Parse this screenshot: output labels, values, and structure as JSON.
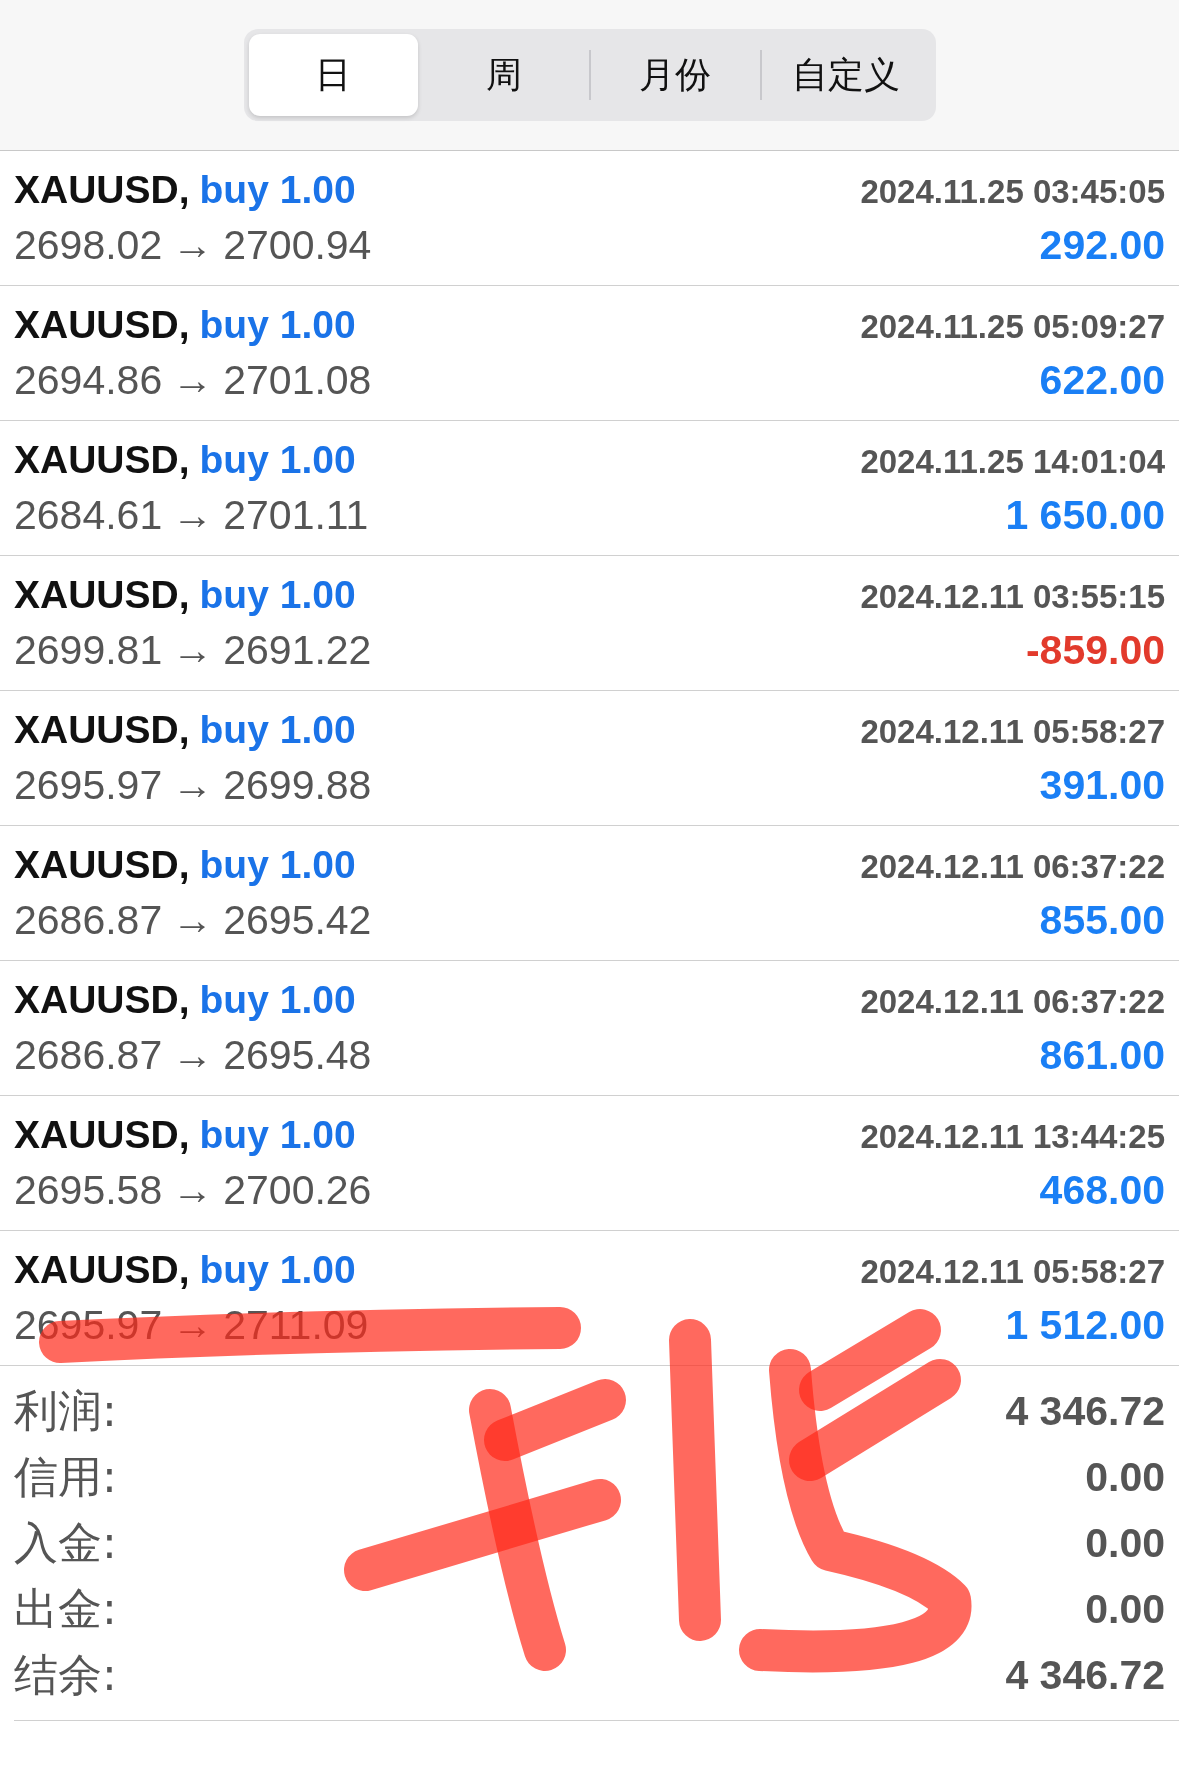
{
  "tabs": [
    {
      "label": "日",
      "selected": true
    },
    {
      "label": "周",
      "selected": false
    },
    {
      "label": "月份",
      "selected": false
    },
    {
      "label": "自定义",
      "selected": false
    }
  ],
  "deals": [
    {
      "symbol": "XAUUSD,",
      "side": "buy 1.00",
      "time": "2024.11.25 03:45:05",
      "open": "2698.02",
      "arrow": "→",
      "close": "2700.94",
      "profit": "292.00",
      "loss": false
    },
    {
      "symbol": "XAUUSD,",
      "side": "buy 1.00",
      "time": "2024.11.25 05:09:27",
      "open": "2694.86",
      "arrow": "→",
      "close": "2701.08",
      "profit": "622.00",
      "loss": false
    },
    {
      "symbol": "XAUUSD,",
      "side": "buy 1.00",
      "time": "2024.11.25 14:01:04",
      "open": "2684.61",
      "arrow": "→",
      "close": "2701.11",
      "profit": "1 650.00",
      "loss": false
    },
    {
      "symbol": "XAUUSD,",
      "side": "buy 1.00",
      "time": "2024.12.11 03:55:15",
      "open": "2699.81",
      "arrow": "→",
      "close": "2691.22",
      "profit": "-859.00",
      "loss": true
    },
    {
      "symbol": "XAUUSD,",
      "side": "buy 1.00",
      "time": "2024.12.11 05:58:27",
      "open": "2695.97",
      "arrow": "→",
      "close": "2699.88",
      "profit": "391.00",
      "loss": false
    },
    {
      "symbol": "XAUUSD,",
      "side": "buy 1.00",
      "time": "2024.12.11 06:37:22",
      "open": "2686.87",
      "arrow": "→",
      "close": "2695.42",
      "profit": "855.00",
      "loss": false
    },
    {
      "symbol": "XAUUSD,",
      "side": "buy 1.00",
      "time": "2024.12.11 06:37:22",
      "open": "2686.87",
      "arrow": "→",
      "close": "2695.48",
      "profit": "861.00",
      "loss": false
    },
    {
      "symbol": "XAUUSD,",
      "side": "buy 1.00",
      "time": "2024.12.11 13:44:25",
      "open": "2695.58",
      "arrow": "→",
      "close": "2700.26",
      "profit": "468.00",
      "loss": false
    },
    {
      "symbol": "XAUUSD,",
      "side": "buy 1.00",
      "time": "2024.12.11 05:58:27",
      "open": "2695.97",
      "arrow": "→",
      "close": "2711.09",
      "profit": "1 512.00",
      "loss": false
    }
  ],
  "summary": [
    {
      "label": "利润:",
      "value": "4 346.72"
    },
    {
      "label": "信用:",
      "value": "0.00"
    },
    {
      "label": "入金:",
      "value": "0.00"
    },
    {
      "label": "出金:",
      "value": "0.00"
    },
    {
      "label": "结余:",
      "value": "4 346.72"
    }
  ]
}
